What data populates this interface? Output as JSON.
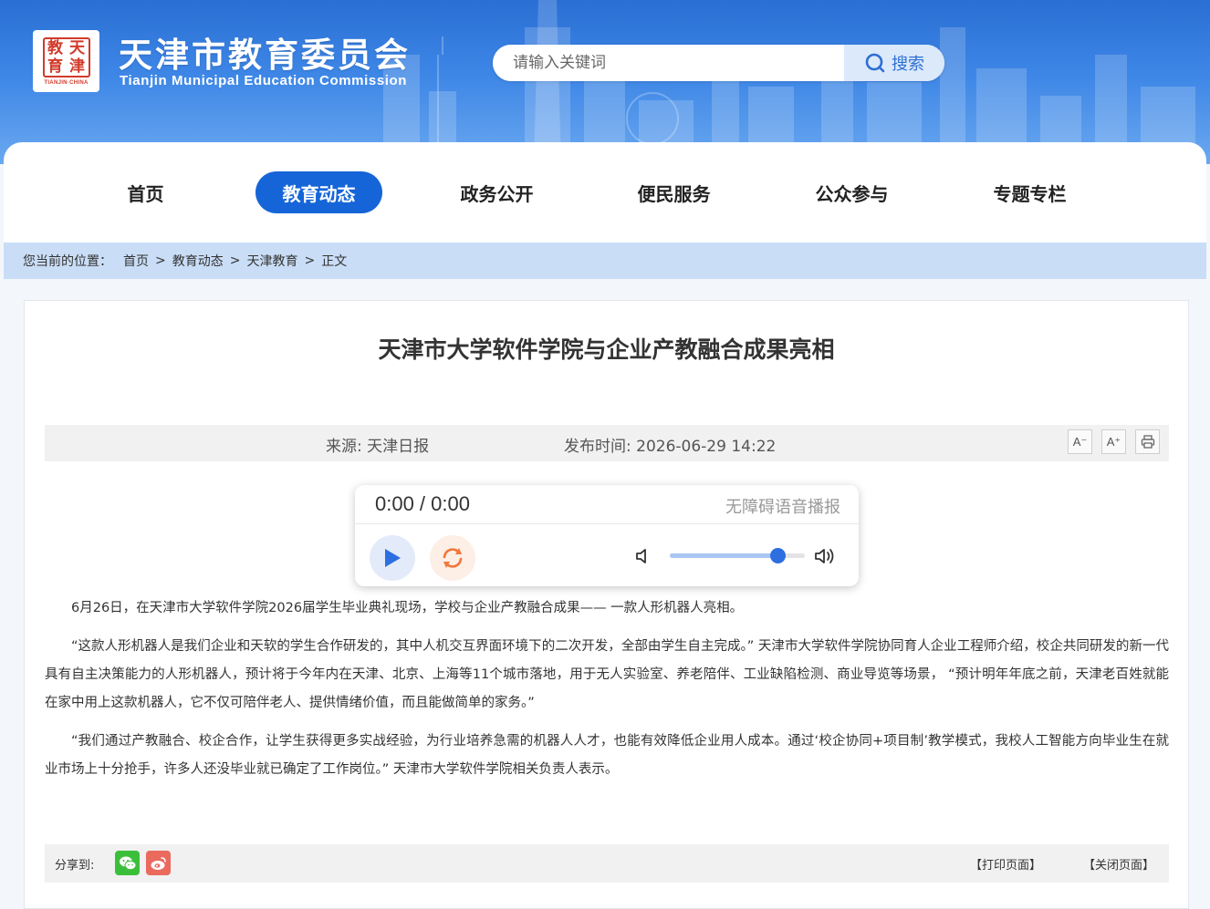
{
  "header": {
    "logo_seal_chars": [
      "天",
      "津",
      "教",
      "育"
    ],
    "logo_caption": "TIANJIN·CHINA",
    "title": "天津市教育委员会",
    "subtitle": "Tianjin Municipal Education Commission",
    "search_placeholder": "请输入关键词",
    "search_button_label": "搜索"
  },
  "nav": {
    "items": [
      {
        "label": "首页",
        "active": false
      },
      {
        "label": "教育动态",
        "active": true
      },
      {
        "label": "政务公开",
        "active": false
      },
      {
        "label": "便民服务",
        "active": false
      },
      {
        "label": "公众参与",
        "active": false
      },
      {
        "label": "专题专栏",
        "active": false
      }
    ]
  },
  "breadcrumb": {
    "prefix": "您当前的位置：",
    "items": [
      "首页",
      "教育动态",
      "天津教育",
      "正文"
    ],
    "separator": ">"
  },
  "article": {
    "title": "天津市大学软件学院与企业产教融合成果亮相",
    "source": "来源:  天津日报",
    "publish_time": "发布时间:  2026-06-29 14:22",
    "tools": {
      "font_smaller": "A⁻",
      "font_larger": "A⁺"
    },
    "paragraphs": [
      "6月26日，在天津市大学软件学院2026届学生毕业典礼现场，学校与企业产教融合成果——  一款人形机器人亮相。",
      "“这款人形机器人是我们企业和天软的学生合作研发的，其中人机交互界面环境下的二次开发，全部由学生自主完成。”  天津市大学软件学院协同育人企业工程师介绍，校企共同研发的新一代具有自主决策能力的人形机器人，预计将于今年内在天津、北京、上海等11个城市落地，用于无人实验室、养老陪伴、工业缺陷检测、商业导览等场景， “预计明年年底之前，天津老百姓就能在家中用上这款机器人，它不仅可陪伴老人、提供情绪价值，而且能做简单的家务。”",
      "“我们通过产教融合、校企合作，让学生获得更多实战经验，为行业培养急需的机器人人才，也能有效降低企业用人成本。通过‘校企协同+项目制’教学模式，我校人工智能方向毕业生在就业市场上十分抢手，许多人还没毕业就已确定了工作岗位。”  天津市大学软件学院相关负责人表示。"
    ]
  },
  "audio": {
    "time_display": "0:00 / 0:00",
    "label": "无障碍语音播报",
    "volume": 0.8
  },
  "share": {
    "label": "分享到:",
    "print_label": "【打印页面】",
    "close_label": "【关闭页面】"
  },
  "colors": {
    "primary": "#1565d8",
    "header_bg": "#3d86e6",
    "breadcrumb_bg": "#c9ddf6",
    "wechat": "#3bbf3b",
    "weibo": "#ea6a5e"
  }
}
